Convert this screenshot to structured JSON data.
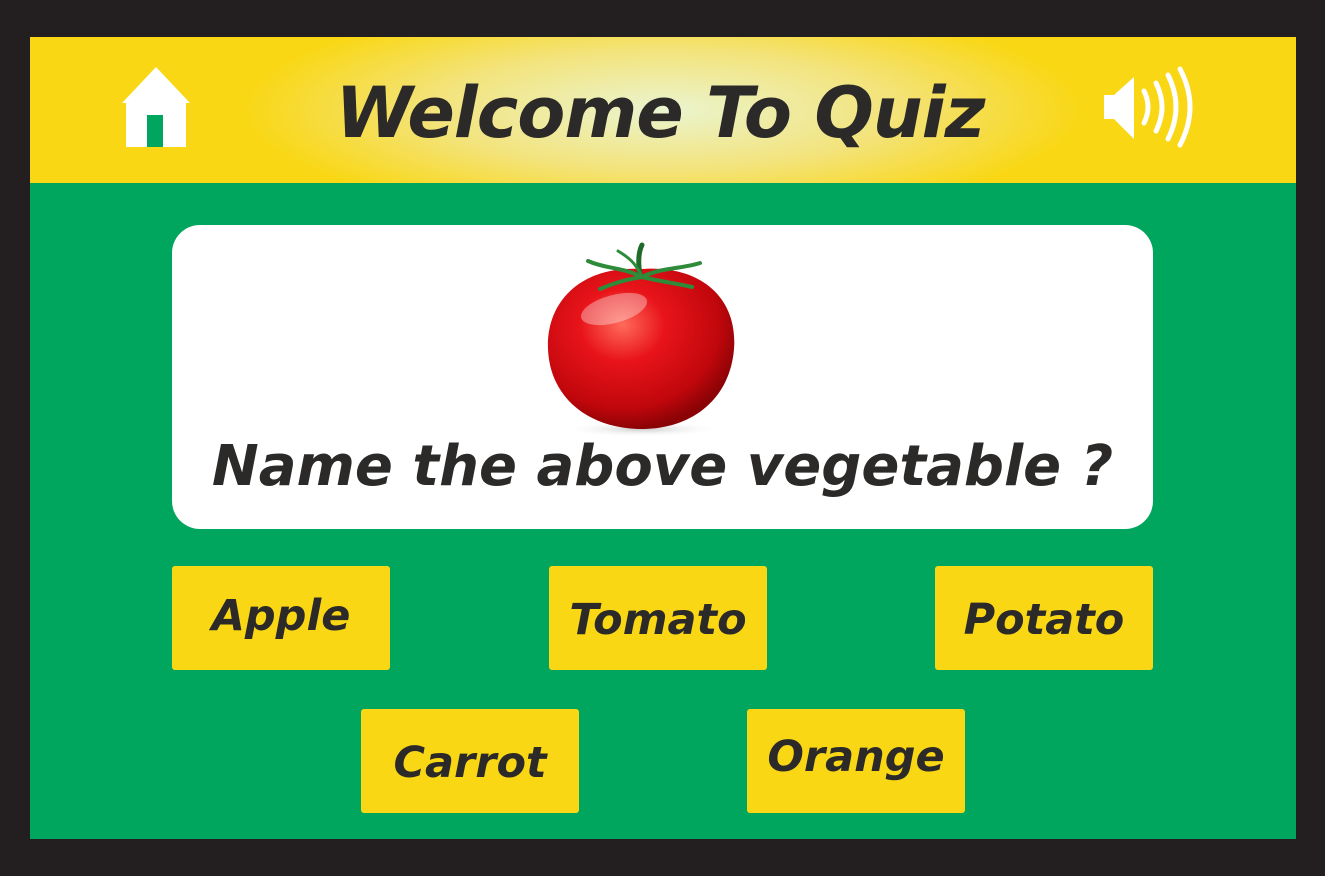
{
  "header": {
    "title": "Welcome To Quiz",
    "home_icon": "home-icon",
    "sound_icon": "speaker-volume-icon"
  },
  "question": {
    "image": "tomato",
    "text": "Name the above vegetable ?"
  },
  "options": [
    {
      "label": "Apple"
    },
    {
      "label": "Tomato"
    },
    {
      "label": "Potato"
    },
    {
      "label": "Carrot"
    },
    {
      "label": "Orange"
    }
  ],
  "colors": {
    "border": "#231f20",
    "background": "#00a65d",
    "header": "#f9d714",
    "option": "#f9d714",
    "text": "#2b2a29",
    "card": "#ffffff"
  }
}
